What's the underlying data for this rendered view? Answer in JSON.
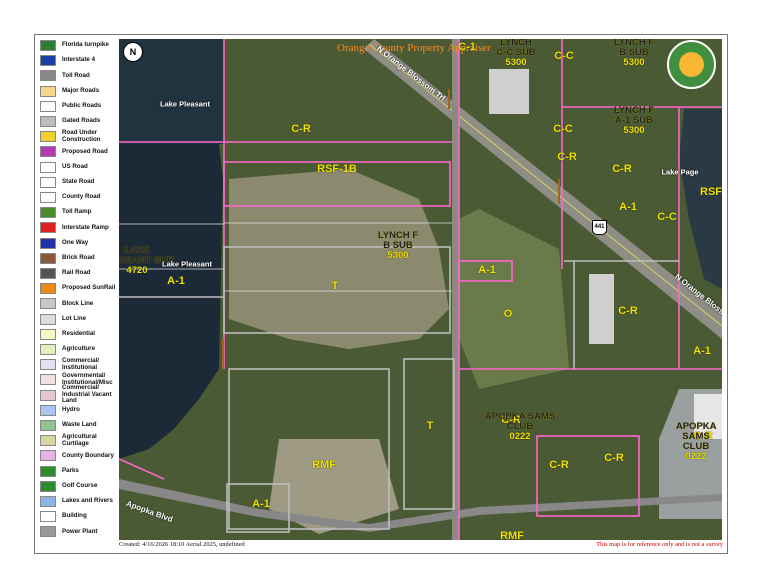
{
  "legend": [
    {
      "label": "Florida turnpike",
      "icon": "turnpike-shield-icon",
      "color": "#2e7d32"
    },
    {
      "label": "Interstate 4",
      "icon": "interstate-shield-icon",
      "color": "#1f3fa8"
    },
    {
      "label": "Toll Road",
      "icon": "toll-road-icon",
      "color": "#888888"
    },
    {
      "label": "Major Roads",
      "icon": "major-road-icon",
      "color": "#f6d48a"
    },
    {
      "label": "Public Roads",
      "icon": "public-road-icon",
      "color": "#ffffff"
    },
    {
      "label": "Gated Roads",
      "icon": "gated-road-icon",
      "color": "#bbbbbb"
    },
    {
      "label": "Road Under\nConstruction",
      "icon": "construction-icon",
      "color": "#f2d22e"
    },
    {
      "label": "Proposed Road",
      "icon": "proposed-road-icon",
      "color": "#b23cb2"
    },
    {
      "label": "US Road",
      "icon": "us-road-shield-icon",
      "color": "#ffffff"
    },
    {
      "label": "State Road",
      "icon": "state-road-shield-icon",
      "color": "#ffffff"
    },
    {
      "label": "County Road",
      "icon": "county-road-shield-icon",
      "color": "#ffffff"
    },
    {
      "label": "Toll Ramp",
      "icon": "toll-ramp-arrow-icon",
      "color": "#4c8c2c"
    },
    {
      "label": "Interstate Ramp",
      "icon": "interstate-ramp-arrow-icon",
      "color": "#d22"
    },
    {
      "label": "One Way",
      "icon": "one-way-arrow-icon",
      "color": "#2233aa"
    },
    {
      "label": "Brick Road",
      "icon": "brick-road-icon",
      "color": "#8a5a3a"
    },
    {
      "label": "Rail Road",
      "icon": "rail-road-icon",
      "color": "#555555"
    },
    {
      "label": "Proposed SunRail",
      "icon": "sunrail-icon",
      "color": "#ee8a1a"
    },
    {
      "label": "Block Line",
      "icon": "block-line-icon",
      "color": "#c8c8c8"
    },
    {
      "label": "Lot Line",
      "icon": "lot-line-icon",
      "color": "#dddddd"
    },
    {
      "label": "Residential",
      "icon": "residential-swatch",
      "color": "#f7f7c4"
    },
    {
      "label": "Agriculture",
      "icon": "agriculture-swatch",
      "color": "#e2f0c2"
    },
    {
      "label": "Commercial/\nInstitutional",
      "icon": "commercial-swatch",
      "color": "#e2e2f4"
    },
    {
      "label": "Governmental/\nInstitutional/Misc",
      "icon": "governmental-swatch",
      "color": "#f4e2e2"
    },
    {
      "label": "Commercial/\nIndustrial Vacant\nLand",
      "icon": "industrial-swatch",
      "color": "#e6c6d2"
    },
    {
      "label": "Hydro",
      "icon": "hydro-swatch",
      "color": "#a9c5f2"
    },
    {
      "label": "Waste Land",
      "icon": "waste-land-swatch",
      "color": "#8fc38f"
    },
    {
      "label": "Agricultural\nCurtilage",
      "icon": "curtilage-swatch",
      "color": "#d8d4a0"
    },
    {
      "label": "County Boundary",
      "icon": "county-boundary-icon",
      "color": "#e8b4e8"
    },
    {
      "label": "Parks",
      "icon": "parks-tree-icon",
      "color": "#2e8b2e"
    },
    {
      "label": "Golf Course",
      "icon": "golf-course-icon",
      "color": "#2e8b2e"
    },
    {
      "label": "Lakes and Rivers",
      "icon": "lakes-icon",
      "color": "#8fb4e8"
    },
    {
      "label": "Building",
      "icon": "building-icon",
      "color": "#ffffff"
    },
    {
      "label": "Power Plant",
      "icon": "power-plant-icon",
      "color": "#999999"
    }
  ],
  "map": {
    "title": "Orange County Property Appraiser",
    "north_label": "N",
    "us_route": "441",
    "zoning_labels": [
      "C-1",
      "C-C",
      "C-C",
      "C-R",
      "RSF-1B",
      "C-R",
      "C-R",
      "RSF",
      "A-1",
      "C-C",
      "A-1",
      "A-1",
      "T",
      "O",
      "C-R",
      "A-1",
      "T",
      "C-R",
      "C-R",
      "C-R",
      "C-R",
      "RMF",
      "A-1",
      "RMF"
    ],
    "subdivisions": [
      {
        "name": "LYNCH\nC-C SUB",
        "code": "5300"
      },
      {
        "name": "LYNCH F\nB SUB",
        "code": "5300"
      },
      {
        "name": "LYNCH F\nA-1 SUB",
        "code": "5300"
      },
      {
        "name": "LYNCH F\nB SUB",
        "code": "5300"
      },
      {
        "name": "LAKE\nPLEASANT SUB",
        "code": "4720"
      },
      {
        "name": "APOPKA SAMS\nCLUB",
        "code": "0222"
      },
      {
        "name": "APOPKA SAMS\nCLUB",
        "code": "0222"
      }
    ],
    "water_labels": [
      "Lake Pleasant",
      "Lake Pleasant",
      "Lake Page"
    ],
    "road_labels": [
      "N Orange Blossom Trl",
      "N Orange Blossom Trl",
      "Apopka Blvd"
    ]
  },
  "footer": {
    "created": "Created: 4/16/2026 18:10   Aerial 2025, undefined",
    "disclaimer": "This map is for reference only and is not a survey"
  },
  "colors": {
    "zoning_line": "#ff66cc",
    "label_text": "#f2e400",
    "subdivision_text": "#222222",
    "block_line": "#bdbdbd"
  }
}
